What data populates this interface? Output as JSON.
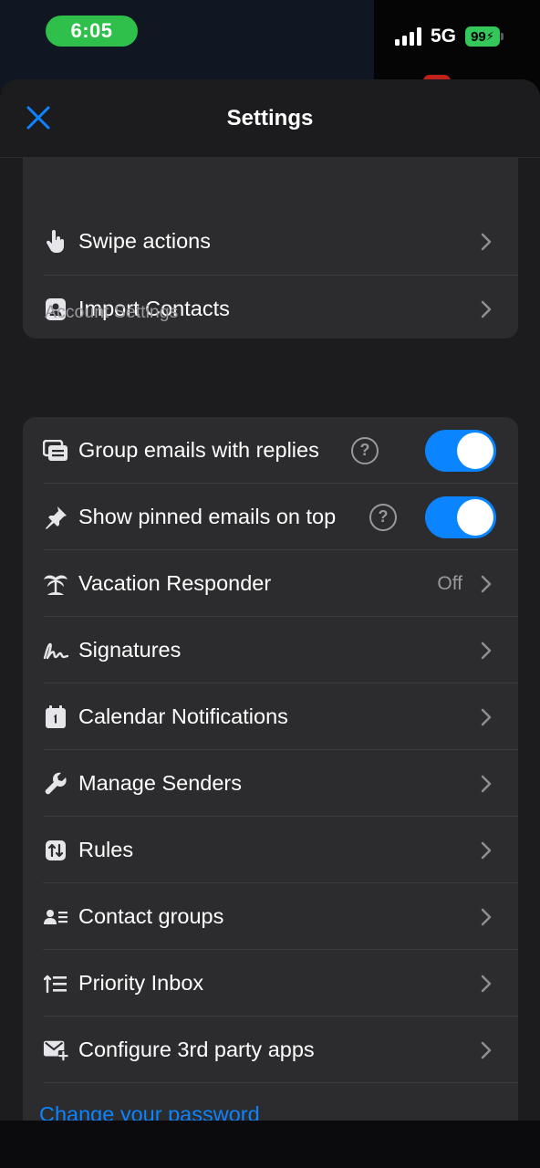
{
  "status_bar": {
    "time": "6:05",
    "network": "5G",
    "battery": "99"
  },
  "nav": {
    "title": "Settings"
  },
  "top_card": {
    "items": [
      {
        "label": "Swipe actions"
      },
      {
        "label": "Import Contacts"
      }
    ]
  },
  "account_settings": {
    "header": "Account Settings",
    "items": [
      {
        "label": "Group emails with replies",
        "toggle": true
      },
      {
        "label": "Show pinned emails on top",
        "toggle": true
      },
      {
        "label": "Vacation Responder",
        "value": "Off"
      },
      {
        "label": "Signatures"
      },
      {
        "label": "Calendar Notifications"
      },
      {
        "label": "Manage Senders"
      },
      {
        "label": "Rules"
      },
      {
        "label": "Contact groups"
      },
      {
        "label": "Priority Inbox"
      },
      {
        "label": "Configure 3rd party apps"
      }
    ],
    "link": "Change your password",
    "help_glyph": "?"
  },
  "colors": {
    "accent": "#0a84ff",
    "toggle_on": "#0a84ff",
    "time_pill": "#2fbf4b",
    "battery": "#34c759"
  }
}
